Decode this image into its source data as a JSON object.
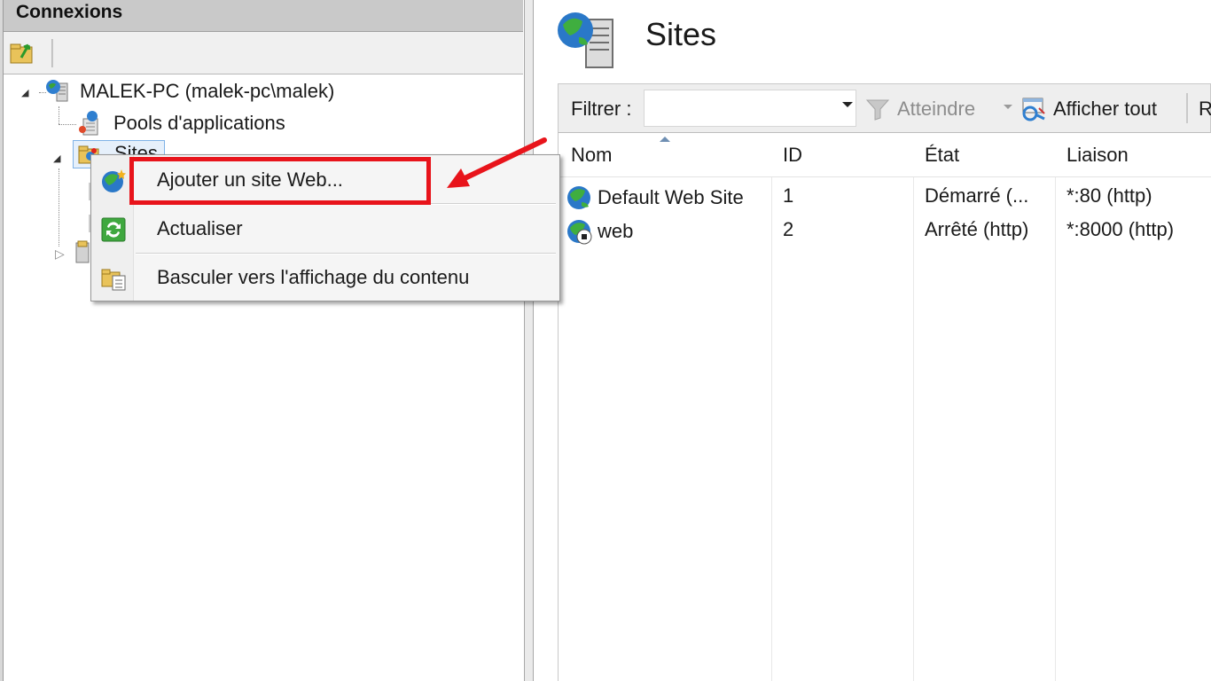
{
  "connections": {
    "header": "Connexions",
    "tree": {
      "server": "MALEK-PC (malek-pc\\malek)",
      "app_pools": "Pools d'applications",
      "sites": "Sites"
    }
  },
  "context_menu": {
    "items": [
      {
        "label": "Ajouter un site Web...",
        "icon": "globe-add-icon",
        "highlighted": true
      },
      {
        "label": "Actualiser",
        "icon": "refresh-icon"
      },
      {
        "label": "Basculer vers l'affichage du contenu",
        "icon": "content-view-icon"
      }
    ],
    "highlight_color": "#e8141b"
  },
  "main": {
    "title": "Sites",
    "filter": {
      "label": "Filtrer :",
      "value": "",
      "goto_label": "Atteindre",
      "show_all_label": "Afficher tout",
      "truncated_next": "R"
    },
    "columns": [
      "Nom",
      "ID",
      "État",
      "Liaison"
    ],
    "rows": [
      {
        "name": "Default Web Site",
        "id": "1",
        "state": "Démarré (...",
        "binding": "*:80 (http)",
        "icon": "globe-site-icon"
      },
      {
        "name": "web",
        "id": "2",
        "state": "Arrêté (http)",
        "binding": "*:8000 (http)",
        "icon": "globe-stopped-icon"
      }
    ]
  },
  "colors": {
    "header_bg": "#c9c9c9",
    "toolbar_bg": "#eeeeee",
    "selection": "#e6f0fb",
    "accent_red": "#e8141b"
  }
}
